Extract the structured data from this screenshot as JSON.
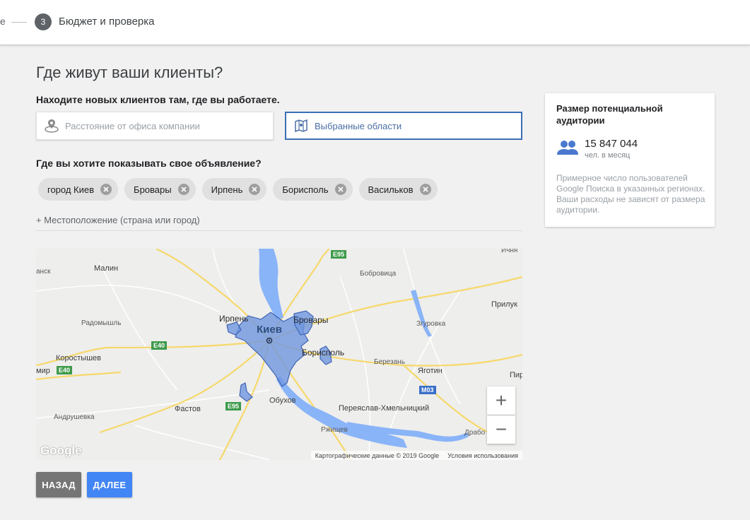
{
  "stepper": {
    "prev_step_text": "е",
    "current_step_number": "3",
    "current_step_label": "Бюджет и проверка"
  },
  "page_title": "Где живут ваши клиенты?",
  "subtitle": "Находите новых клиентов там, где вы работаете.",
  "options": {
    "distance_label": "Расстояние от офиса компании",
    "regions_label": "Выбранные области",
    "selected": "regions"
  },
  "where_label": "Где вы хотите показывать свое объявление?",
  "locations": [
    {
      "label": "город Киев"
    },
    {
      "label": "Бровары"
    },
    {
      "label": "Ирпень"
    },
    {
      "label": "Борисполь"
    },
    {
      "label": "Васильков"
    }
  ],
  "add_location_label": "+ Местоположение (страна или город)",
  "map": {
    "labels": {
      "kiev": "Киев",
      "malin": "Малин",
      "ichnya": "Ичня",
      "bobrovitsa": "Бобровица",
      "pryluky": "Прилук",
      "radomyshl": "Радомышль",
      "irpen": "Ирпень",
      "brovary": "Бровары",
      "zgurovka": "Згуровка",
      "boryspil": "Борисполь",
      "korostyshev": "Коростышев",
      "berezan": "Березань",
      "yagotyn": "Яготин",
      "zhytomyr": "мир",
      "pyr": "Пир",
      "obukhov": "Обухов",
      "fastov": "Фастов",
      "pereyaslav": "Переяслав-Хмельницкий",
      "andrushevka": "Андрушевка",
      "rzhyshchev": "Ржищев",
      "drabov": "Драбо",
      "ansk": "анск"
    },
    "shields": {
      "e95_top": "E95",
      "e40_mid": "E40",
      "e40_left": "E40",
      "e95_bottom": "E95",
      "m03": "M03"
    },
    "zoom_in": "+",
    "zoom_out": "−",
    "logo": "Google",
    "attribution": "Картографические данные © 2019 Google",
    "terms": "Условия использования",
    "highlight_color": "#6f96e0"
  },
  "buttons": {
    "back": "НАЗАД",
    "next": "ДАЛЕЕ"
  },
  "audience": {
    "title": "Размер потенциальной аудитории",
    "value": "15 847 044",
    "unit": "чел. в месяц",
    "note": "Примерное число пользователей Google Поиска в указанных регионах. Ваши расходы не зависят от размера аудитории."
  },
  "colors": {
    "accent": "#4285f4",
    "selected_border": "#3b6fb6",
    "back_button": "#757575"
  }
}
